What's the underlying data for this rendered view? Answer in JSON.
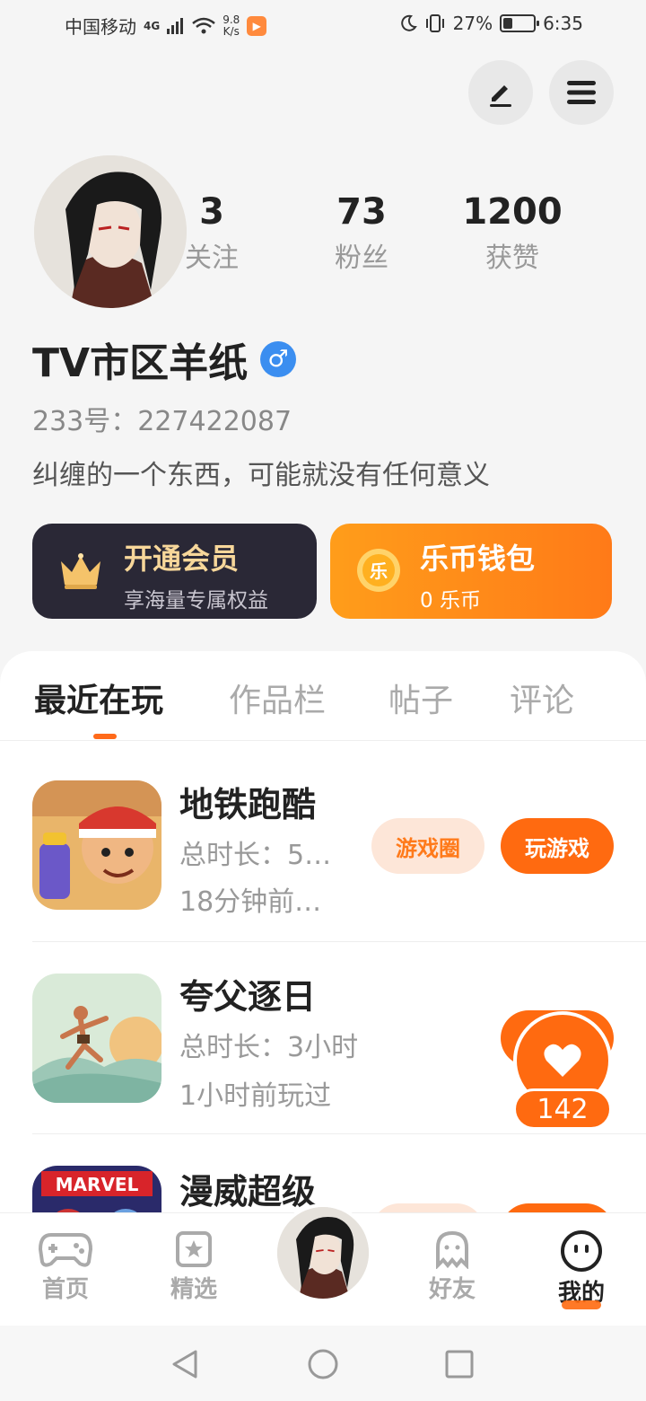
{
  "status_bar": {
    "carrier": "中国移动",
    "network": "4G",
    "speed_value": "9.8",
    "speed_unit": "K/s",
    "battery": "27%",
    "time": "6:35"
  },
  "profile": {
    "stats": [
      {
        "value": "3",
        "label": "关注"
      },
      {
        "value": "73",
        "label": "粉丝"
      },
      {
        "value": "1200",
        "label": "获赞"
      }
    ],
    "username": "TV市区羊纸",
    "gender_symbol": "♂",
    "uid": "233号：227422087",
    "bio": "纠缠的一个东西，可能就没有任何意义"
  },
  "cards": {
    "vip": {
      "title": "开通会员",
      "subtitle": "享海量专属权益"
    },
    "wallet": {
      "title": "乐币钱包",
      "subtitle": "0 乐币",
      "coin_glyph": "乐"
    }
  },
  "tabs": [
    "最近在玩",
    "作品栏",
    "帖子",
    "评论"
  ],
  "games": [
    {
      "name": "地铁跑酷",
      "total_time": "总时长：5…",
      "last_played": "18分钟前…",
      "circle_label": "游戏圈",
      "play_label": "玩游戏"
    },
    {
      "name": "夸父逐日",
      "total_time": "总时长：3小时",
      "last_played": "1小时前玩过"
    },
    {
      "name": "漫威超级"
    }
  ],
  "like": {
    "count": "142"
  },
  "bottom_nav": {
    "home": "首页",
    "featured": "精选",
    "friends": "好友",
    "mine": "我的"
  },
  "colors": {
    "accent": "#ff6a10",
    "vip_bg": "#2a2836",
    "gender_blue": "#3b8ef0"
  }
}
